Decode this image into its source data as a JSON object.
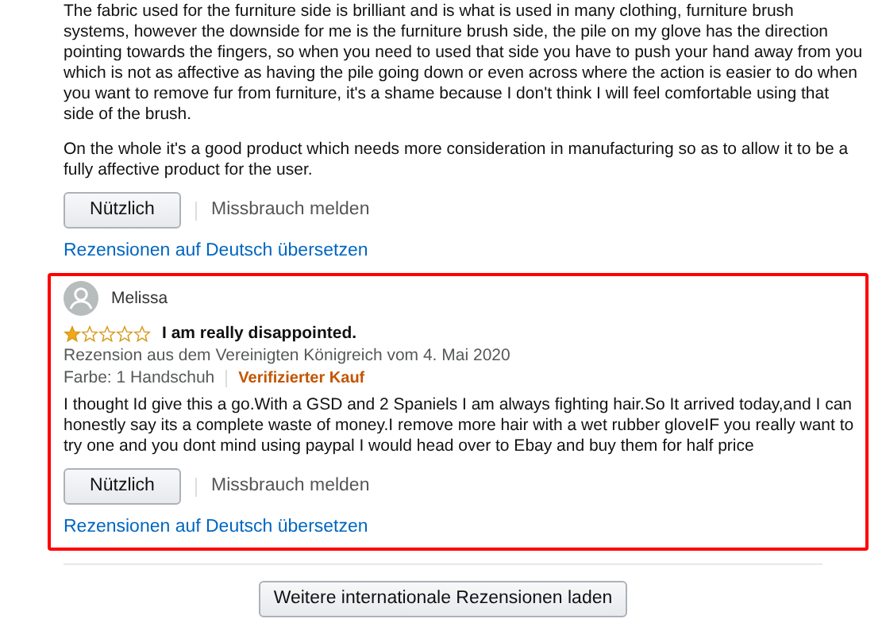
{
  "previous_review": {
    "paragraphs": [
      "The fabric used for the furniture side is brilliant and is what is used in many clothing, furniture brush systems, however the downside for me is the furniture brush side, the pile on my glove has the direction pointing towards the fingers, so when you need to used that side you have to push your hand away from you which is not as affective as having the pile going down or even across where the action is easier to do when you want to remove fur from furniture, it's a shame because I don't think I will feel comfortable using that side of the brush.",
      "On the whole it's a good product which needs more consideration in manufacturing so as to allow it to be a fully affective product for the user."
    ],
    "helpful_button": "Nützlich",
    "report_link": "Missbrauch melden",
    "translate_link": "Rezensionen auf Deutsch übersetzen"
  },
  "highlighted_review": {
    "author": "Melissa",
    "stars": 1,
    "title": "I am really disappointed.",
    "date_line": "Rezension aus dem Vereinigten Königreich vom 4. Mai 2020",
    "variant": "Farbe: 1 Handschuh",
    "verified": "Verifizierter Kauf",
    "body": "I thought Id give this a go.With a GSD and 2 Spaniels I am always fighting hair.So It arrived today,and I can honestly say its a complete waste of money.I remove more hair with a wet rubber gloveIF you really want to try one and you dont mind using paypal I would head over to Ebay and buy them for half price",
    "helpful_button": "Nützlich",
    "report_link": "Missbrauch melden",
    "translate_link": "Rezensionen auf Deutsch übersetzen"
  },
  "load_more_button": "Weitere internationale Rezensionen laden"
}
